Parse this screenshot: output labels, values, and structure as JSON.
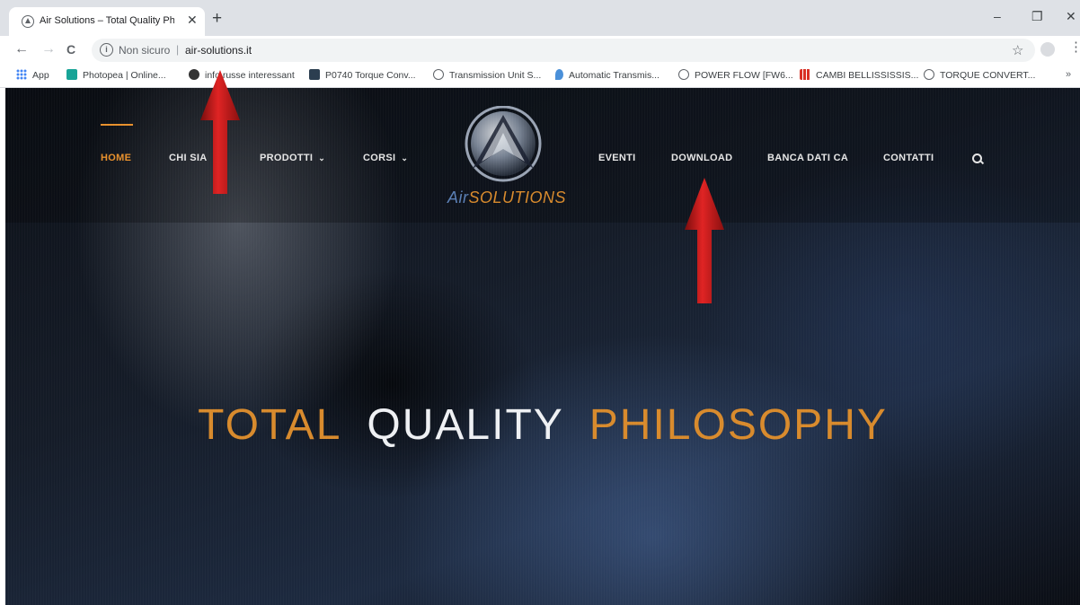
{
  "browser": {
    "tab_title": "Air Solutions – Total Quality Philo",
    "tab_close": "✕",
    "new_tab": "+",
    "back": "←",
    "forward": "→",
    "reload": "C",
    "info_glyph": "i",
    "security_label": "Non sicuro",
    "separator": "|",
    "url": "air-solutions.it",
    "star": "☆",
    "window": {
      "minimize": "–",
      "restore": "❐",
      "close": "✕"
    }
  },
  "bookmarks": [
    {
      "label": "App",
      "icon": "apps-grid-icon",
      "color": "#4285f4"
    },
    {
      "label": "Photopea | Online...",
      "icon": "photopea-icon",
      "color": "#18a497"
    },
    {
      "label": "info russe interessant",
      "icon": "bug-icon",
      "color": "#333333"
    },
    {
      "label": "P0740 Torque Conv...",
      "icon": "z-icon",
      "color": "#2c3e50"
    },
    {
      "label": "Transmission Unit S...",
      "icon": "globe-icon",
      "color": "#5f6368"
    },
    {
      "label": "Automatic Transmis...",
      "icon": "drop-icon",
      "color": "#4a90d9"
    },
    {
      "label": "POWER FLOW [FW6...",
      "icon": "globe-icon",
      "color": "#5f6368"
    },
    {
      "label": "CAMBI BELLISSISSIS...",
      "icon": "bars-icon",
      "color": "#d93025"
    },
    {
      "label": "TORQUE CONVERT...",
      "icon": "globe-icon",
      "color": "#5f6368"
    }
  ],
  "bookmarks_more": "»",
  "site": {
    "nav": {
      "home": "HOME",
      "chi_siamo": "CHI SIA",
      "prodotti": "PRODOTTI",
      "corsi": "CORSI",
      "eventi": "EVENTI",
      "download": "DOWNLOAD",
      "banca_dati": "BANCA DATI CA",
      "contatti": "CONTATTI",
      "dropdown_glyph": "⌄"
    },
    "logo": {
      "prefix": "Air",
      "suffix": "SOLUTIONS"
    },
    "hero": {
      "word1": "TOTAL",
      "word2": "QUALITY",
      "word3": "PHILOSOPHY"
    },
    "colors": {
      "accent": "#d88a2c",
      "arrow": "#c81c1c"
    }
  }
}
